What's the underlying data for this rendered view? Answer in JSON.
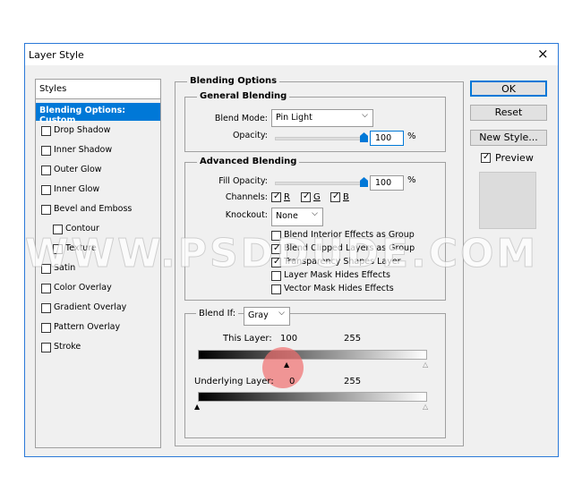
{
  "window": {
    "title": "Layer Style",
    "close_icon": "×"
  },
  "sidebar": {
    "header": "Styles",
    "items": [
      {
        "label": "Blending Options: Custom",
        "selected": true
      },
      {
        "label": "Drop Shadow",
        "checked": false
      },
      {
        "label": "Inner Shadow",
        "checked": false
      },
      {
        "label": "Outer Glow",
        "checked": false
      },
      {
        "label": "Inner Glow",
        "checked": false
      },
      {
        "label": "Bevel and Emboss",
        "checked": false
      },
      {
        "label": "Contour",
        "checked": false,
        "sub": true
      },
      {
        "label": "Texture",
        "checked": false,
        "sub": true
      },
      {
        "label": "Satin",
        "checked": false
      },
      {
        "label": "Color Overlay",
        "checked": false
      },
      {
        "label": "Gradient Overlay",
        "checked": false
      },
      {
        "label": "Pattern Overlay",
        "checked": false
      },
      {
        "label": "Stroke",
        "checked": false
      }
    ]
  },
  "main": {
    "title": "Blending Options",
    "general": {
      "title": "General Blending",
      "blend_mode_label": "Blend Mode:",
      "blend_mode": "Pin Light",
      "opacity_label": "Opacity:",
      "opacity": "100",
      "pct": "%"
    },
    "advanced": {
      "title": "Advanced Blending",
      "fill_label": "Fill Opacity:",
      "fill": "100",
      "pct": "%",
      "channels_label": "Channels:",
      "r": "R",
      "g": "G",
      "b": "B",
      "knockout_label": "Knockout:",
      "knockout": "None",
      "options": [
        {
          "label": "Blend Interior Effects as Group",
          "checked": false
        },
        {
          "label": "Blend Clipped Layers as Group",
          "checked": true
        },
        {
          "label": "Transparency Shapes Layer",
          "checked": true
        },
        {
          "label": "Layer Mask Hides Effects",
          "checked": false
        },
        {
          "label": "Vector Mask Hides Effects",
          "checked": false
        }
      ]
    },
    "blendif": {
      "label": "Blend If:",
      "value": "Gray",
      "this_label": "This Layer:",
      "this_low": "100",
      "this_high": "255",
      "under_label": "Underlying Layer:",
      "under_low": "0",
      "under_high": "255"
    }
  },
  "buttons": {
    "ok": "OK",
    "reset": "Reset",
    "new_style": "New Style...",
    "preview": "Preview",
    "preview_checked": true
  },
  "watermark": "WWW.PSDDUDE.COM",
  "colors": {
    "accent": "#0078d7",
    "highlight": "#f08080"
  }
}
